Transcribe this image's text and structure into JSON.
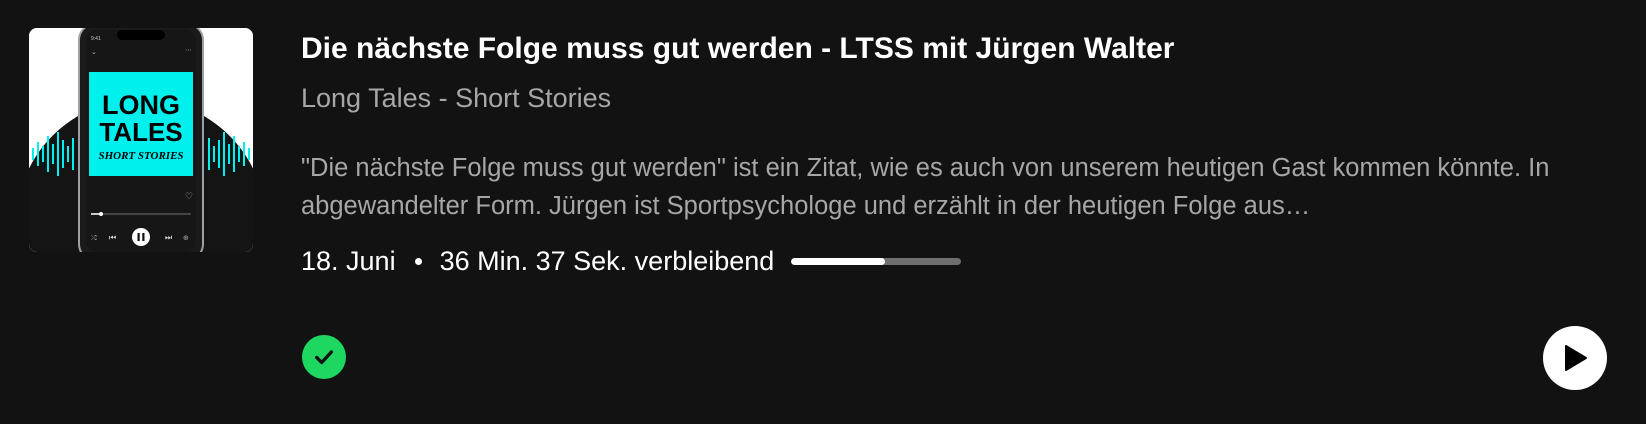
{
  "episode": {
    "title": "Die nächste Folge muss gut werden - LTSS mit Jürgen Walter",
    "show": "Long Tales - Short Stories",
    "description": "\"Die nächste Folge muss gut werden\" ist ein Zitat, wie es auch von unserem heutigen Gast kommen könnte. In abgewandelter Form. Jürgen ist Sportpsychologe und erzählt in der heutigen Folge aus…",
    "date": "18. Juni",
    "remaining": "36 Min. 37 Sek. verbleibend",
    "progress_fraction": 0.55
  },
  "cover_art": {
    "line1": "LONG",
    "line2": "TALES",
    "line3": "SHORT STORIES",
    "phone_time": "9:41",
    "accent_color": "#00f0ee"
  },
  "icons": {
    "played": "check-icon",
    "play": "play-icon"
  },
  "colors": {
    "background": "#121212",
    "text_primary": "#ffffff",
    "text_secondary": "#a7a7a7",
    "accent_green": "#1ed760",
    "progress_track": "#6f6f6f"
  }
}
